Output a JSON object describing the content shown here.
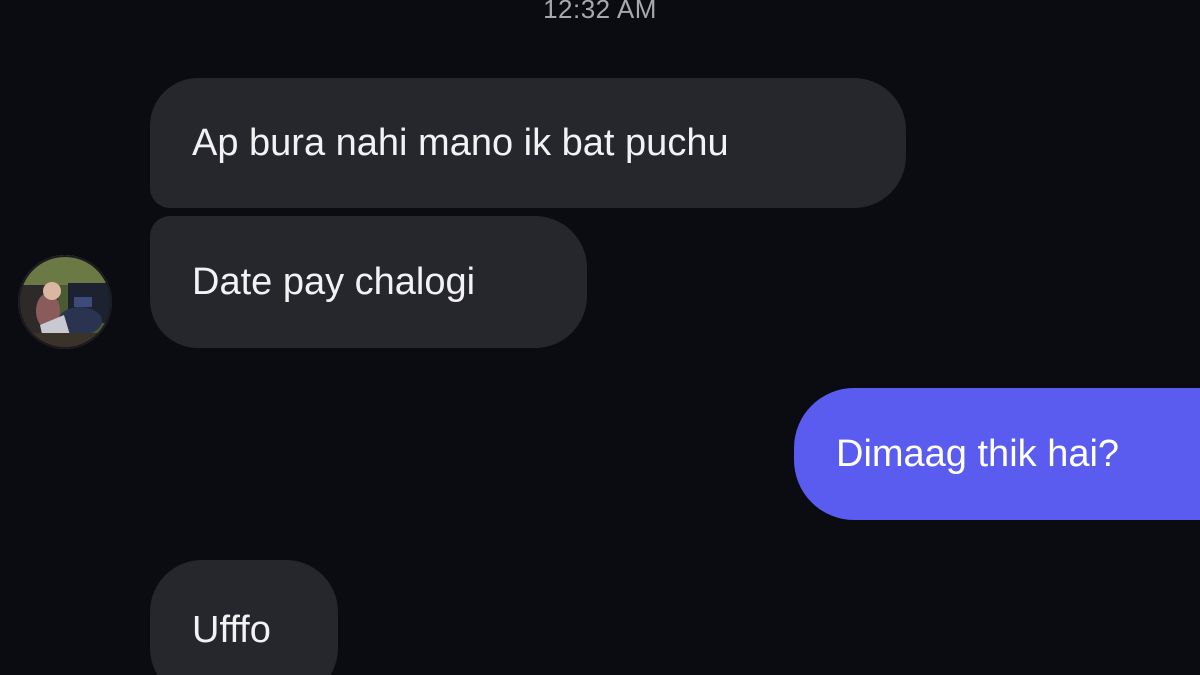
{
  "conversation": {
    "timestamp": "12:32 AM",
    "contact_avatar_icon": "profile-photo-icon",
    "messages": [
      {
        "direction": "incoming",
        "text": "Ap bura nahi mano ik bat puchu"
      },
      {
        "direction": "incoming",
        "text": "Date pay chalogi"
      },
      {
        "direction": "outgoing",
        "text": "Dimaag thik hai?"
      },
      {
        "direction": "incoming",
        "text": "Ufffo"
      }
    ]
  },
  "colors": {
    "background": "#0b0b12",
    "incoming_bubble": "#26262d",
    "outgoing_bubble": "#5a5cf0",
    "timestamp_text": "#a7a7ad"
  }
}
